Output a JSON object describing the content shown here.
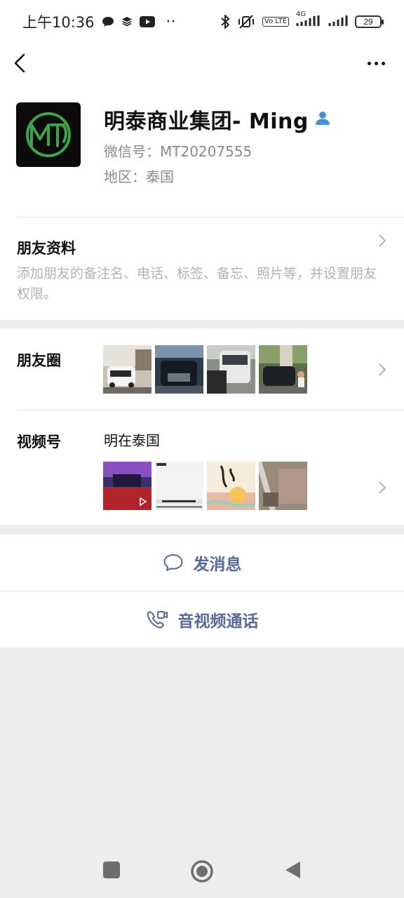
{
  "status_bar": {
    "time": "上午10:36",
    "network": "4G",
    "volte": "Vo LTE",
    "battery": "29",
    "dots": "··"
  },
  "profile": {
    "name": "明泰商业集团- Ming",
    "wechat_id": "微信号：MT20207555",
    "region": "地区：泰国",
    "avatar_initials": "MTI"
  },
  "friend_info": {
    "title": "朋友资料",
    "description": "添加朋友的备注名、电话、标签、备忘、照片等，并设置朋友权限。"
  },
  "moments": {
    "label": "朋友圈"
  },
  "channels": {
    "label": "视频号",
    "name": "明在泰国"
  },
  "actions": {
    "message": "发消息",
    "call": "音视频通话"
  },
  "colors": {
    "link": "#576b95",
    "avatar_green": "#3ea34a",
    "background": "#ededed"
  }
}
